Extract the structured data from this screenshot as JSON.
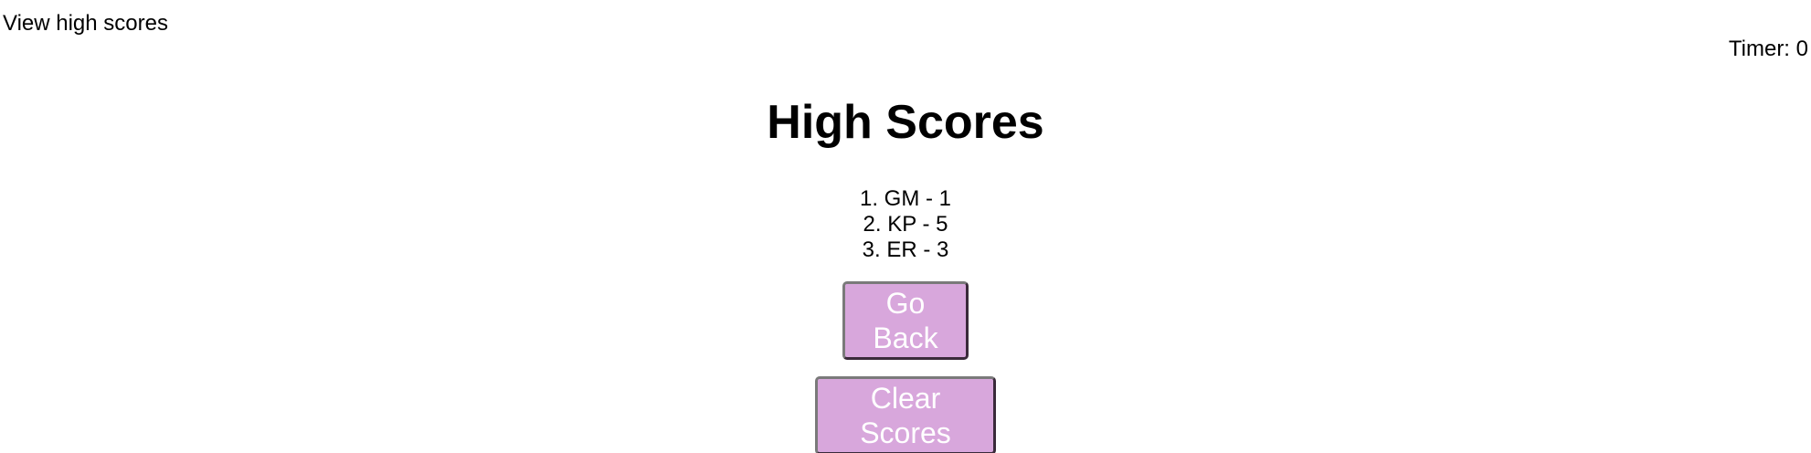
{
  "nav": {
    "view_high_scores": "View high scores",
    "timer": "Timer: 0"
  },
  "main": {
    "title": "High Scores",
    "scores": [
      "1. GM - 1",
      "2. KP - 5",
      "3. ER - 3"
    ],
    "go_back_label": "Go Back",
    "clear_scores_label": "Clear Scores"
  },
  "colors": {
    "button_bg": "#d8a7dc",
    "button_text": "#ffffff"
  }
}
